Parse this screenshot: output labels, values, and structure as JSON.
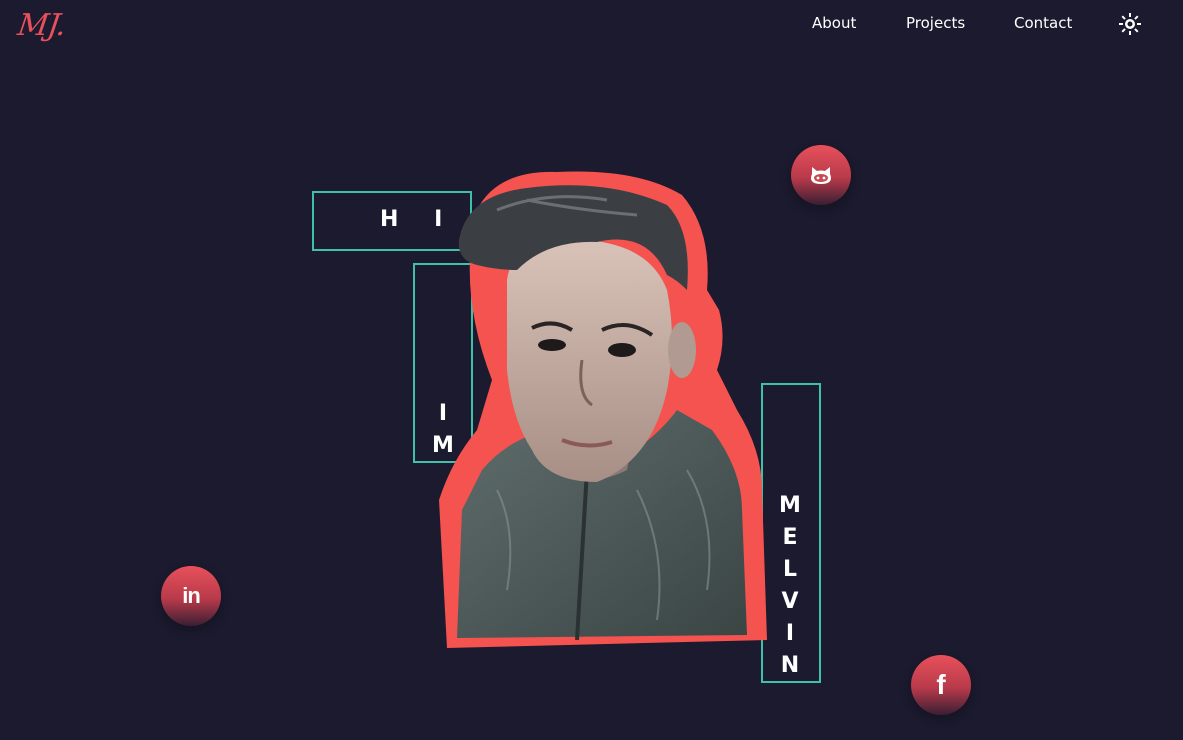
{
  "header": {
    "logo": "MJ.",
    "nav": {
      "about": "About",
      "projects": "Projects",
      "contact": "Contact"
    },
    "theme_icon": "sun-icon"
  },
  "hero": {
    "word_hi": "H I",
    "word_im": [
      "I",
      "M"
    ],
    "word_melvin": [
      "M",
      "E",
      "L",
      "V",
      "I",
      "N"
    ]
  },
  "social": {
    "github_icon": "github-icon",
    "linkedin_label": "in",
    "facebook_label": "f"
  },
  "colors": {
    "background": "#1b1a2e",
    "accent": "#e8505b",
    "frame": "#3ec1a8"
  }
}
